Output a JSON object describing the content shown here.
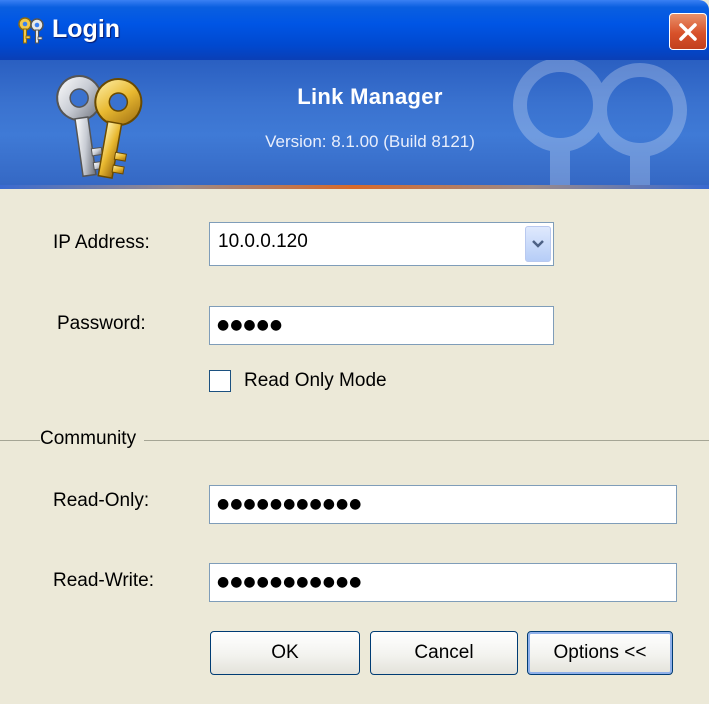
{
  "window": {
    "title": "Login"
  },
  "banner": {
    "app_name": "Link Manager",
    "version": "Version: 8.1.00 (Build 8121)"
  },
  "form": {
    "ip_label": "IP Address:",
    "ip_value": "10.0.0.120",
    "password_label": "Password:",
    "password_value": "●●●●●",
    "read_only_mode_label": "Read Only Mode",
    "read_only_mode_checked": false
  },
  "community": {
    "group_label": "Community",
    "read_only_label": "Read-Only:",
    "read_only_value": "●●●●●●●●●●●",
    "read_write_label": "Read-Write:",
    "read_write_value": "●●●●●●●●●●●"
  },
  "buttons": {
    "ok": "OK",
    "cancel": "Cancel",
    "options": "Options <<"
  },
  "colors": {
    "titlebar": "#0055e5",
    "dialog_bg": "#ece9d8",
    "close_button": "#d8512a",
    "banner": "#3a72cf"
  }
}
